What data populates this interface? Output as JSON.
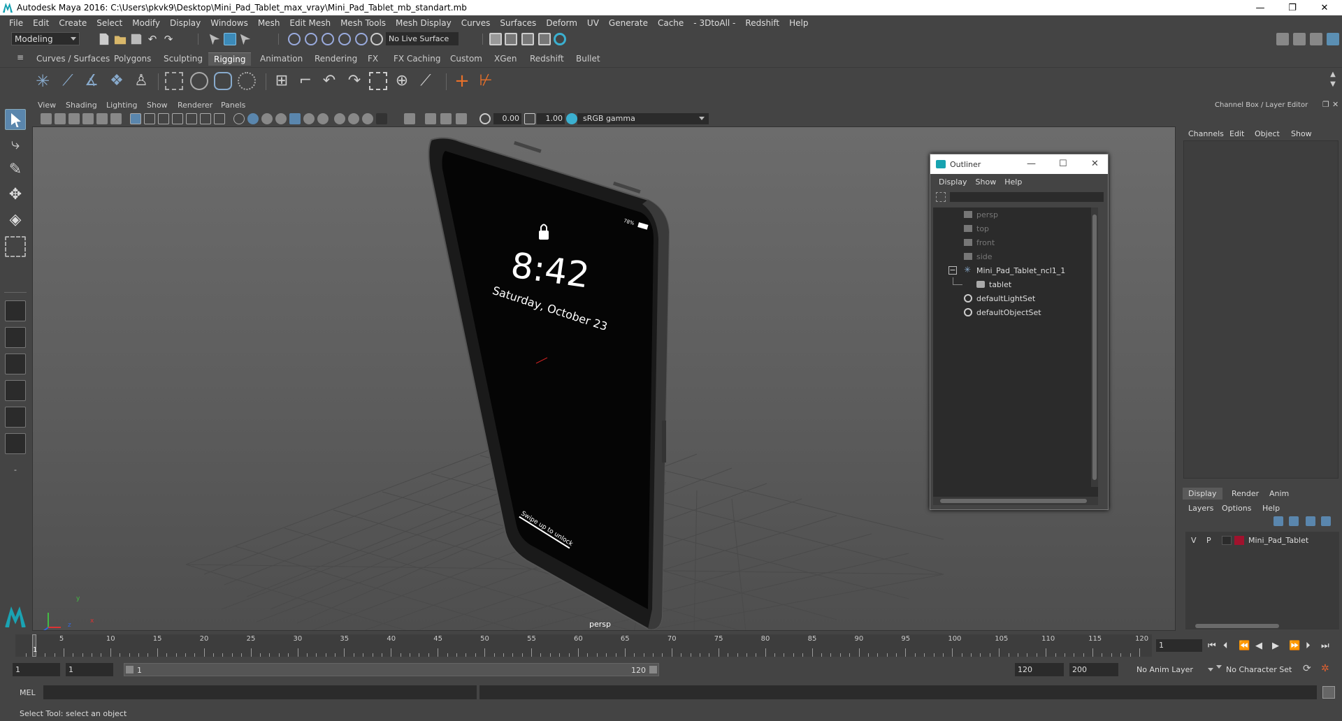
{
  "window": {
    "title": "Autodesk Maya 2016: C:\\Users\\pkvk9\\Desktop\\Mini_Pad_Tablet_max_vray\\Mini_Pad_Tablet_mb_standart.mb",
    "minimize": "—",
    "maximize": "❐",
    "close": "✕"
  },
  "menubar": [
    "File",
    "Edit",
    "Create",
    "Select",
    "Modify",
    "Display",
    "Windows",
    "Mesh",
    "Edit Mesh",
    "Mesh Tools",
    "Mesh Display",
    "Curves",
    "Surfaces",
    "Deform",
    "UV",
    "Generate",
    "Cache",
    "- 3DtoAll -",
    "Redshift",
    "Help"
  ],
  "toolbar": {
    "mode": "Modeling",
    "live_surface": "No Live Surface"
  },
  "shelf_tabs": [
    "Curves / Surfaces",
    "Polygons",
    "Sculpting",
    "Rigging",
    "Animation",
    "Rendering",
    "FX",
    "FX Caching",
    "Custom",
    "XGen",
    "Redshift",
    "Bullet"
  ],
  "active_shelf_tab": "Rigging",
  "viewport": {
    "menus": [
      "View",
      "Shading",
      "Lighting",
      "Show",
      "Renderer",
      "Panels"
    ],
    "exposure": "0.00",
    "gamma": "1.00",
    "color_space": "sRGB gamma",
    "camera_label": "persp",
    "axis_x": "x",
    "axis_y": "y",
    "axis_z": "z",
    "tablet_screen": {
      "time": "8:42",
      "date": "Saturday, October 23",
      "battery": "78%",
      "unlock_hint": "Swipe up to unlock"
    }
  },
  "outliner": {
    "title": "Outliner",
    "menus": [
      "Display",
      "Show",
      "Help"
    ],
    "items": [
      {
        "label": "persp",
        "type": "camera",
        "dim": true
      },
      {
        "label": "top",
        "type": "camera",
        "dim": true
      },
      {
        "label": "front",
        "type": "camera",
        "dim": true
      },
      {
        "label": "side",
        "type": "camera",
        "dim": true
      },
      {
        "label": "Mini_Pad_Tablet_ncl1_1",
        "type": "group",
        "dim": false,
        "expand": "−"
      },
      {
        "label": "tablet",
        "type": "mesh",
        "dim": false
      },
      {
        "label": "defaultLightSet",
        "type": "set",
        "dim": false
      },
      {
        "label": "defaultObjectSet",
        "type": "set",
        "dim": false
      }
    ]
  },
  "channel_box": {
    "title": "Channel Box / Layer Editor",
    "menus": [
      "Channels",
      "Edit",
      "Object",
      "Show"
    ]
  },
  "layer_editor": {
    "tabs": [
      "Display",
      "Render",
      "Anim"
    ],
    "active_tab": "Display",
    "menus": [
      "Layers",
      "Options",
      "Help"
    ],
    "layers": [
      {
        "visible": "V",
        "playback": "P",
        "name": "Mini_Pad_Tablet",
        "color": "#a0122d"
      }
    ]
  },
  "timeline": {
    "ticks": [
      "5",
      "10",
      "15",
      "20",
      "25",
      "30",
      "35",
      "40",
      "45",
      "50",
      "55",
      "60",
      "65",
      "70",
      "75",
      "80",
      "85",
      "90",
      "95",
      "100",
      "105",
      "110",
      "115",
      "120"
    ],
    "current_frame": "1",
    "current_frame_field": "1"
  },
  "range": {
    "start": "1",
    "playback_start": "1",
    "slider_start": "1",
    "slider_end": "120",
    "playback_end": "120",
    "end": "200",
    "anim_layer": "No Anim Layer",
    "character_set": "No Character Set"
  },
  "command_line": {
    "label": "MEL"
  },
  "help_line": "Select Tool: select an object"
}
